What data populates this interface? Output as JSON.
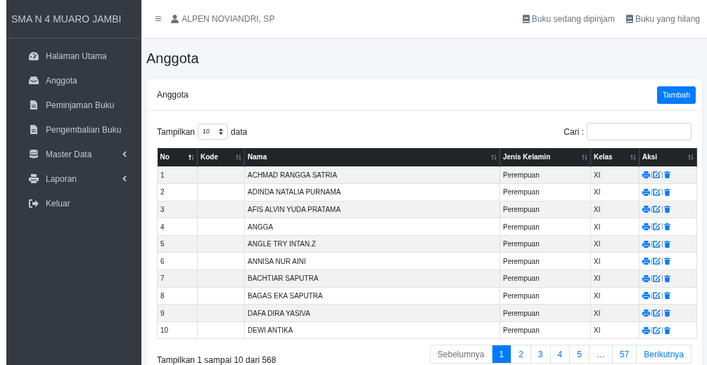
{
  "sidebar": {
    "brand": "SMA N 4 MUARO JAMBI",
    "items": [
      {
        "label": "Halaman Utama",
        "kind": "gauge",
        "has_submenu": false
      },
      {
        "label": "Anggota",
        "kind": "inbox",
        "has_submenu": false
      },
      {
        "label": "Peminjaman Buku",
        "kind": "file",
        "has_submenu": false
      },
      {
        "label": "Pengembalian Buku",
        "kind": "file",
        "has_submenu": false
      },
      {
        "label": "Master Data",
        "kind": "database",
        "has_submenu": true
      },
      {
        "label": "Laporan",
        "kind": "printer",
        "has_submenu": true
      },
      {
        "label": "Keluar",
        "kind": "signout",
        "has_submenu": false
      }
    ]
  },
  "topbar": {
    "menu_icon": "≡",
    "user": "ALPEN NOVIANDRI, SP",
    "links": [
      "Buku sedang dipinjam",
      "Buku yang hilang"
    ]
  },
  "page_title": "Anggota",
  "card": {
    "title": "Anggota",
    "add_button": "Tambah",
    "length": {
      "label_before": "Tampilkan",
      "value": "10",
      "label_after": "data"
    },
    "search": {
      "label": "Cari :"
    },
    "table": {
      "columns": [
        {
          "label": "No",
          "sorted": true
        },
        {
          "label": "Kode",
          "sorted": false
        },
        {
          "label": "Nama",
          "sorted": false
        },
        {
          "label": "Jenis Kelamin",
          "sorted": false
        },
        {
          "label": "Kelas",
          "sorted": false
        },
        {
          "label": "Aksi",
          "sorted": false
        }
      ],
      "action_separator": "|",
      "rows": [
        {
          "no": "1",
          "kode": "",
          "nama": "ACHMAD RANGGA SATRIA",
          "jenis_kelamin": "Perempuan",
          "kelas": "XI"
        },
        {
          "no": "2",
          "kode": "",
          "nama": "ADINDA NATALIA PURNAMA",
          "jenis_kelamin": "Perempuan",
          "kelas": "XI"
        },
        {
          "no": "3",
          "kode": "",
          "nama": "AFIS ALVIN YUDA PRATAMA",
          "jenis_kelamin": "Perempuan",
          "kelas": "XI"
        },
        {
          "no": "4",
          "kode": "",
          "nama": "ANGGA",
          "jenis_kelamin": "Perempuan",
          "kelas": "XI"
        },
        {
          "no": "5",
          "kode": "",
          "nama": "ANGLE TRY INTAN.Z",
          "jenis_kelamin": "Perempuan",
          "kelas": "XI"
        },
        {
          "no": "6",
          "kode": "",
          "nama": "ANNISA NUR AINI",
          "jenis_kelamin": "Perempuan",
          "kelas": "XI"
        },
        {
          "no": "7",
          "kode": "",
          "nama": "BACHTIAR SAPUTRA",
          "jenis_kelamin": "Perempuan",
          "kelas": "XI"
        },
        {
          "no": "8",
          "kode": "",
          "nama": "BAGAS EKA SAPUTRA",
          "jenis_kelamin": "Perempuan",
          "kelas": "XI"
        },
        {
          "no": "9",
          "kode": "",
          "nama": "DAFA DIRA YASIVA",
          "jenis_kelamin": "Perempuan",
          "kelas": "XI"
        },
        {
          "no": "10",
          "kode": "",
          "nama": "DEWI ANTIKA",
          "jenis_kelamin": "Perempuan",
          "kelas": "XI"
        }
      ]
    },
    "info": "Tampilkan 1 sampai 10 dari 568",
    "pagination": [
      {
        "label": "Sebelumnya",
        "selected": false
      },
      {
        "label": "1",
        "selected": true
      },
      {
        "label": "2",
        "selected": false
      },
      {
        "label": "3",
        "selected": false
      },
      {
        "label": "4",
        "selected": false
      },
      {
        "label": "5",
        "selected": false
      },
      {
        "label": "…",
        "selected": false
      },
      {
        "label": "57",
        "selected": false
      },
      {
        "label": "Berikutnya",
        "selected": false
      }
    ]
  }
}
